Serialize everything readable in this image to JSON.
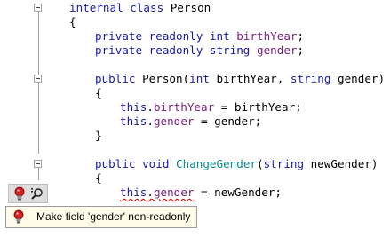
{
  "code": {
    "line1": {
      "kw": "internal class",
      "rest": " Person"
    },
    "line2": {
      "text": "{"
    },
    "line3": {
      "kw1": "private readonly int",
      "field": "birthYear",
      "end": ";"
    },
    "line4": {
      "kw1": "private readonly string",
      "field": "gender",
      "end": ";"
    },
    "line6": {
      "kw": "public",
      "name": " Person(",
      "kw2": "int",
      "mid": " birthYear, ",
      "kw3": "string",
      "end": " gender)"
    },
    "line7": {
      "text": "{"
    },
    "line8": {
      "kw": "this",
      "dot": ".",
      "field": "birthYear",
      "rest": " = birthYear;"
    },
    "line9": {
      "kw": "this",
      "dot": ".",
      "field": "gender",
      "rest": " = gender;"
    },
    "line10": {
      "text": "}"
    },
    "line12": {
      "kw": "public void",
      "sp": " ",
      "method": "ChangeGender",
      "paren": "(",
      "kw2": "string",
      "rest": " newGender)"
    },
    "line13": {
      "text": "{"
    },
    "line14": {
      "kw": "this",
      "dot": ".",
      "field": "gender",
      "rest": " = newGender;"
    }
  },
  "quickfix": {
    "label": "Make field 'gender' non-readonly"
  },
  "icons": {
    "bulb": "lightbulb-icon",
    "inspect": "inspect-magnifier-icon",
    "fold": "collapse-icon"
  },
  "colors": {
    "keyword": "#1a1aa6",
    "field": "#7b1f7d",
    "method": "#0b8a8a",
    "popup_bg": "#fefce8",
    "error_squiggle": "#d00000"
  }
}
